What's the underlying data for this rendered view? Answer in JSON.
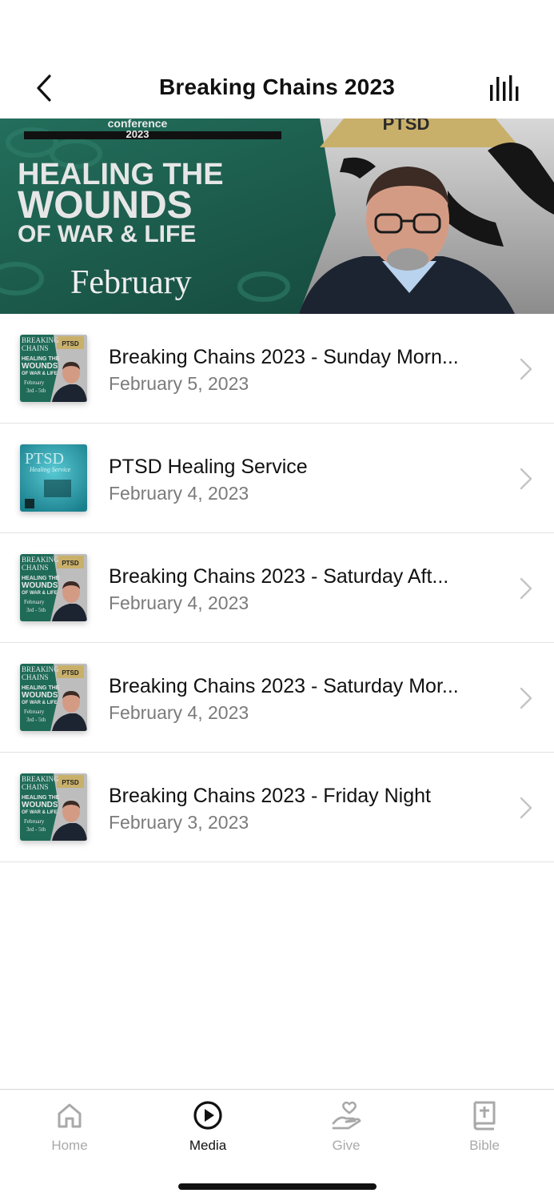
{
  "header": {
    "title": "Breaking Chains 2023",
    "back_icon": "chevron-left-icon",
    "menu_icon": "audio-bars-icon"
  },
  "banner": {
    "top_text_1": "conference",
    "top_text_2": "2023",
    "badge_text": "PTSD",
    "line_1": "HEALING THE",
    "line_2": "WOUNDS",
    "line_3": "OF WAR & LIFE",
    "month": "February"
  },
  "items": [
    {
      "title": "Breaking Chains 2023 - Sunday Morn...",
      "date": "February 5, 2023",
      "thumb": "breaking-chains"
    },
    {
      "title": "PTSD Healing Service",
      "date": "February 4, 2023",
      "thumb": "ptsd"
    },
    {
      "title": "Breaking Chains 2023 - Saturday Aft...",
      "date": "February 4, 2023",
      "thumb": "breaking-chains"
    },
    {
      "title": "Breaking Chains 2023 - Saturday Mor...",
      "date": "February 4, 2023",
      "thumb": "breaking-chains"
    },
    {
      "title": "Breaking Chains 2023 - Friday Night",
      "date": "February 3, 2023",
      "thumb": "breaking-chains"
    }
  ],
  "thumb_text": {
    "bc_line_1": "BREAKING",
    "bc_line_2": "CHAINS",
    "bc_line_3": "HEALING THE",
    "bc_line_4": "WOUNDS",
    "bc_line_5": "OF WAR & LIFE",
    "bc_line_6": "February",
    "bc_line_7": "3rd - 5th",
    "bc_badge": "PTSD",
    "ptsd_line_1": "PTSD",
    "ptsd_line_2": "Healing Service"
  },
  "tabs": [
    {
      "label": "Home",
      "icon": "home-icon",
      "active": false
    },
    {
      "label": "Media",
      "icon": "play-circle-icon",
      "active": true
    },
    {
      "label": "Give",
      "icon": "heart-hand-icon",
      "active": false
    },
    {
      "label": "Bible",
      "icon": "bible-icon",
      "active": false
    }
  ],
  "colors": {
    "banner_green": "#1c5b4c",
    "badge_gold": "#c9b06a",
    "ptsd_teal": "#2aa7b4",
    "inactive_tab": "#a9a9a9"
  }
}
